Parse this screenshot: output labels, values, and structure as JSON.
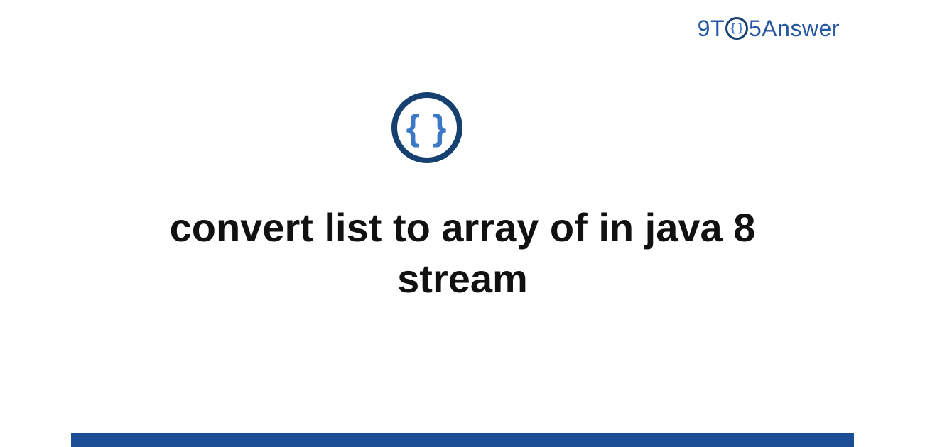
{
  "logo": {
    "part1": "9T",
    "braces": "{ }",
    "part2": "5Answer"
  },
  "icon": {
    "braces": "{ }"
  },
  "title": "convert list to array of in java 8 stream"
}
